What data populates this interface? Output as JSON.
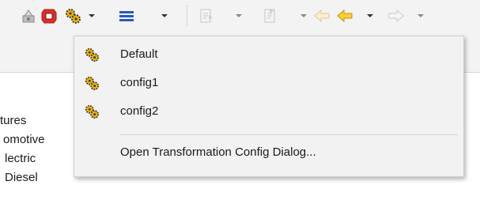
{
  "toolbar": {
    "icons": [
      "transform-run-icon",
      "stop-icon",
      "gear-config-icon",
      "layout-lines-icon",
      "step-into-icon",
      "step-over-icon",
      "back-icon",
      "back-active-icon",
      "forward-icon"
    ],
    "colors": {
      "accent_blue": "#2f57b8",
      "stop_red": "#d9302c",
      "arrow_yellow": "#f0b400",
      "gear_dark": "#3a3a3a"
    }
  },
  "tree": {
    "items": [
      "tures",
      "omotive",
      "lectric",
      "Diesel"
    ]
  },
  "menu": {
    "items": [
      {
        "label": "Default",
        "icon": "gear-config-icon"
      },
      {
        "label": "config1",
        "icon": "gear-config-icon"
      },
      {
        "label": "config2",
        "icon": "gear-config-icon"
      }
    ],
    "dialog_label": "Open Transformation Config Dialog..."
  }
}
